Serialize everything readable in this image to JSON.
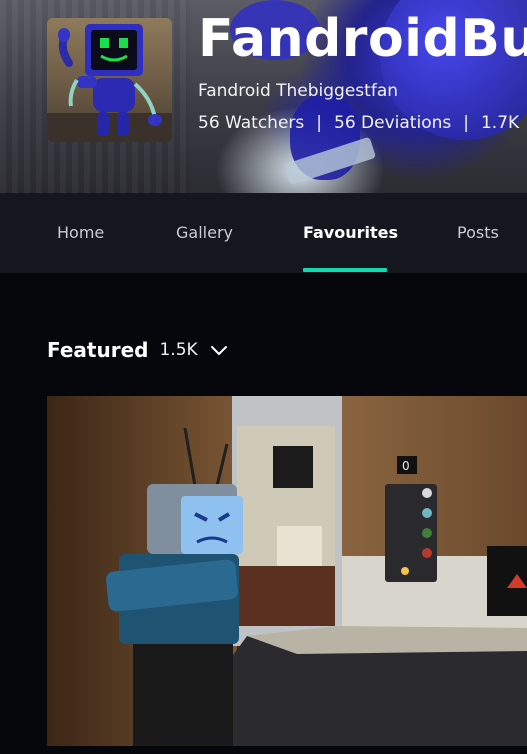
{
  "profile": {
    "username": "FandroidBu",
    "real_name": "Fandroid Thebiggestfan",
    "stats": {
      "watchers": "56 Watchers",
      "deviations": "56 Deviations",
      "more": "1.7K"
    },
    "separator": "|"
  },
  "nav": {
    "tabs": [
      {
        "label": "Home"
      },
      {
        "label": "Gallery"
      },
      {
        "label": "Favourites"
      },
      {
        "label": "Posts"
      }
    ],
    "active_tab": "Favourites",
    "accent_color": "#13d9b0"
  },
  "featured": {
    "title": "Featured",
    "count": "1.5K",
    "dropdown_icon": "chevron-down-icon"
  },
  "hero_image": {
    "elevator_floor": "0"
  }
}
